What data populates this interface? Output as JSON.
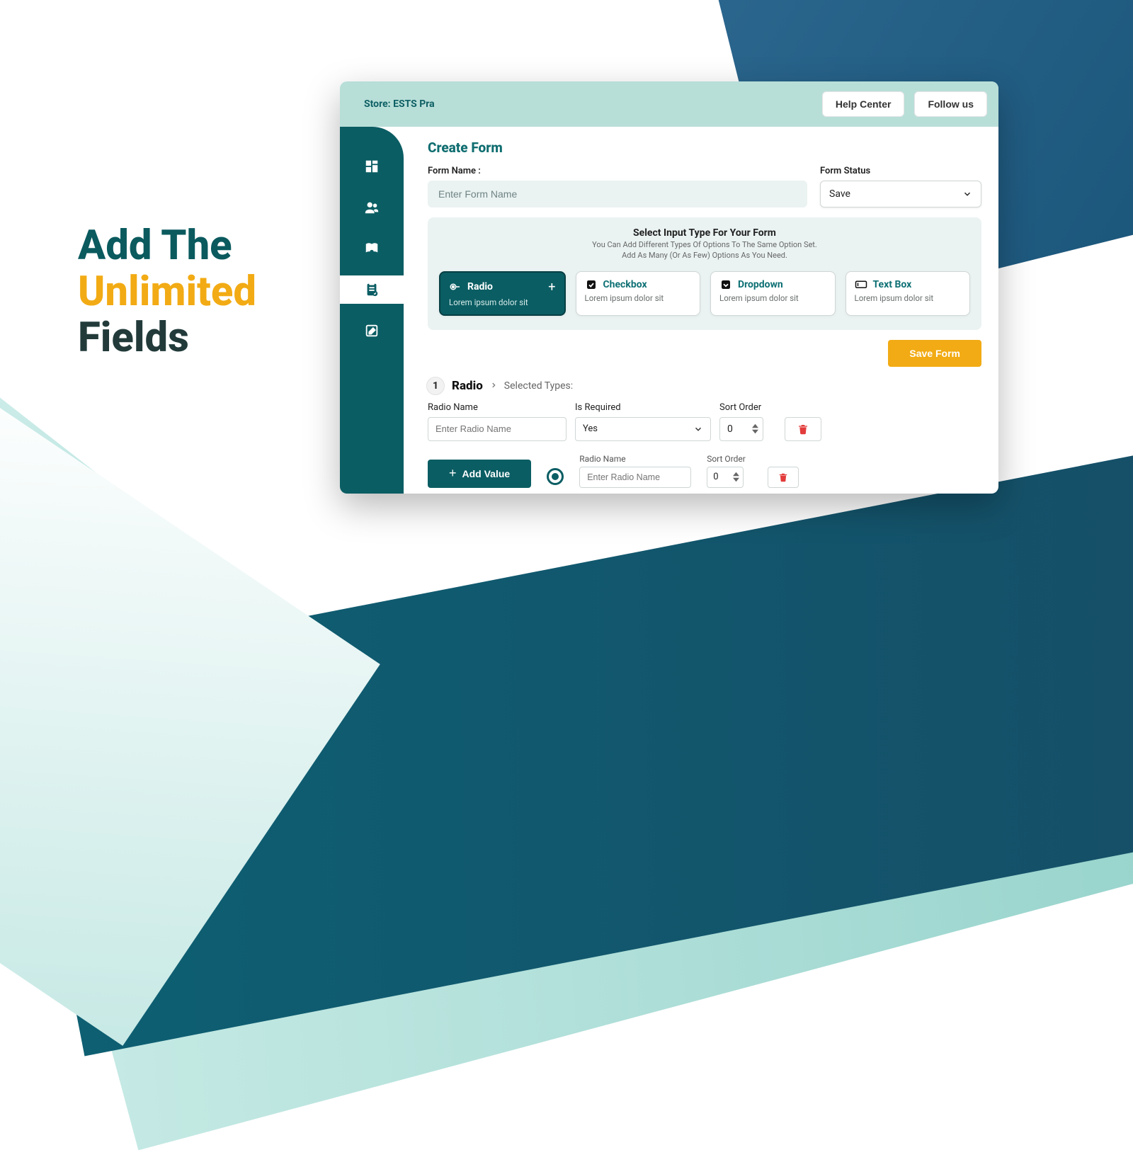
{
  "hero": {
    "line1": "Add The",
    "line2": "Unlimited",
    "line3": "Fields"
  },
  "topbar": {
    "store_prefix": "Store: ",
    "store_name": "ESTS Pra",
    "help": "Help Center",
    "follow": "Follow us"
  },
  "page": {
    "title": "Create Form",
    "form_name_label": "Form Name :",
    "form_name_placeholder": "Enter Form Name",
    "form_status_label": "Form Status",
    "form_status_value": "Save"
  },
  "panel": {
    "title": "Select Input Type For Your Form",
    "sub1": "You Can Add Different Types Of Options To The Same Option Set.",
    "sub2": "Add As Many (Or As Few) Options As You Need."
  },
  "types": [
    {
      "name": "Radio",
      "desc": "Lorem ipsum dolor sit",
      "active": true
    },
    {
      "name": "Checkbox",
      "desc": "Lorem ipsum dolor sit",
      "active": false
    },
    {
      "name": "Dropdown",
      "desc": "Lorem ipsum dolor sit",
      "active": false
    },
    {
      "name": "Text Box",
      "desc": "Lorem ipsum dolor sit",
      "active": false
    }
  ],
  "save_form": "Save Form",
  "crumb": {
    "step": "1",
    "main": "Radio",
    "sub": "Selected Types:"
  },
  "radio_field": {
    "name_label": "Radio Name",
    "name_placeholder": "Enter Radio Name",
    "required_label": "Is Required",
    "required_value": "Yes",
    "sort_label": "Sort Order",
    "sort_value": "0"
  },
  "add_value": "Add Value",
  "value_row": {
    "name_label": "Radio Name",
    "name_placeholder": "Enter Radio Name",
    "sort_label": "Sort Order",
    "sort_value": "0"
  }
}
